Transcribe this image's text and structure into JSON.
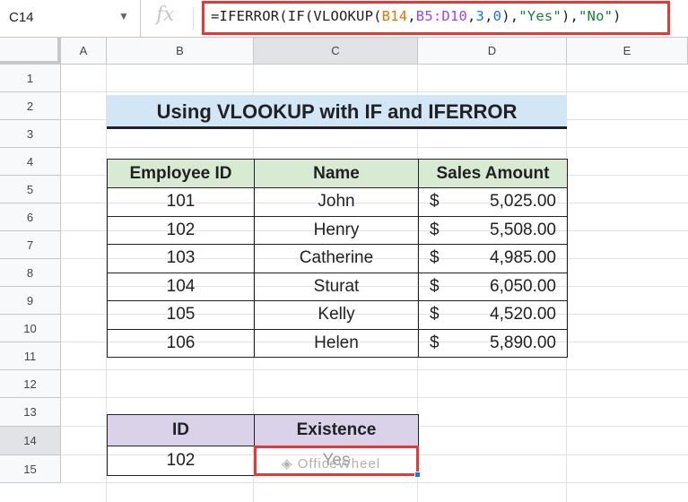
{
  "formula_bar": {
    "name_box": "C14",
    "fx": "fx",
    "formula_parts": [
      {
        "text": "=IFERROR(IF(VLOOKUP(",
        "cls": ""
      },
      {
        "text": "B14",
        "cls": "ref1"
      },
      {
        "text": ",",
        "cls": ""
      },
      {
        "text": "B5:D10",
        "cls": "ref2"
      },
      {
        "text": ",",
        "cls": ""
      },
      {
        "text": "3",
        "cls": "num"
      },
      {
        "text": ",",
        "cls": ""
      },
      {
        "text": "0",
        "cls": "num"
      },
      {
        "text": "),",
        "cls": ""
      },
      {
        "text": "\"Yes\"",
        "cls": "str"
      },
      {
        "text": "),",
        "cls": ""
      },
      {
        "text": "\"No\"",
        "cls": "str"
      },
      {
        "text": ")",
        "cls": ""
      }
    ]
  },
  "columns": [
    "A",
    "B",
    "C",
    "D",
    "E"
  ],
  "rows": [
    "1",
    "2",
    "3",
    "4",
    "5",
    "6",
    "7",
    "8",
    "9",
    "10",
    "11",
    "12",
    "13",
    "14",
    "15"
  ],
  "title": "Using VLOOKUP with IF and IFERROR",
  "employee_table": {
    "headers": [
      "Employee ID",
      "Name",
      "Sales Amount"
    ],
    "rows": [
      {
        "id": "101",
        "name": "John",
        "currency": "$",
        "amount": "5,025.00"
      },
      {
        "id": "102",
        "name": "Henry",
        "currency": "$",
        "amount": "5,508.00"
      },
      {
        "id": "103",
        "name": "Catherine",
        "currency": "$",
        "amount": "4,985.00"
      },
      {
        "id": "104",
        "name": "Sturat",
        "currency": "$",
        "amount": "6,050.00"
      },
      {
        "id": "105",
        "name": "Kelly",
        "currency": "$",
        "amount": "4,520.00"
      },
      {
        "id": "106",
        "name": "Helen",
        "currency": "$",
        "amount": "5,890.00"
      }
    ]
  },
  "lookup_table": {
    "headers": [
      "ID",
      "Existence"
    ],
    "id_value": "102",
    "existence_value": "Yes"
  },
  "watermark": "OfficeWheel",
  "colors": {
    "highlight": "#e53935",
    "title_bg": "#d3e6f6",
    "header_green": "#d9ead3",
    "header_purple": "#d9d2e9"
  }
}
